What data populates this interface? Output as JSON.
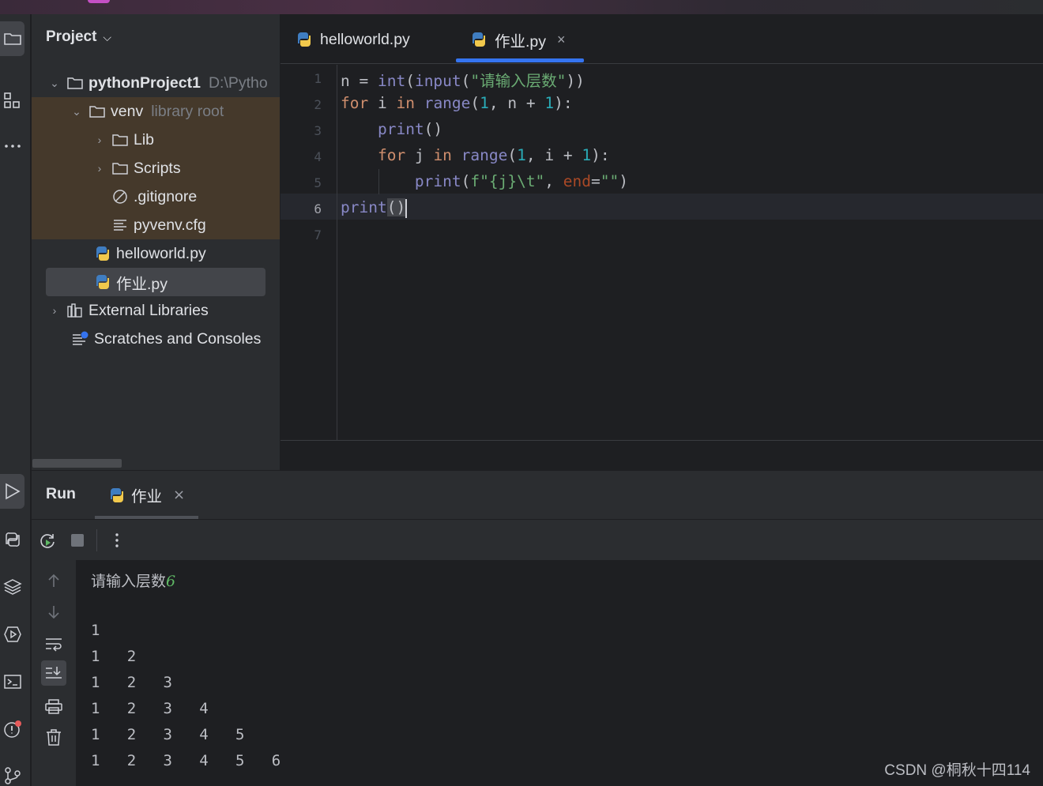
{
  "project_panel": {
    "header": "Project",
    "tree": [
      {
        "label": "pythonProject1",
        "hint": "D:\\Pytho"
      },
      {
        "label": "venv",
        "hint": "library root"
      },
      {
        "label": "Lib"
      },
      {
        "label": "Scripts"
      },
      {
        "label": ".gitignore"
      },
      {
        "label": "pyvenv.cfg"
      },
      {
        "label": "helloworld.py"
      },
      {
        "label": "作业.py"
      },
      {
        "label": "External Libraries"
      },
      {
        "label": "Scratches and Consoles"
      }
    ]
  },
  "editor": {
    "tabs": [
      {
        "label": "helloworld.py"
      },
      {
        "label": "作业.py",
        "close": "×"
      }
    ],
    "line_numbers": [
      "1",
      "2",
      "3",
      "4",
      "5",
      "6",
      "7"
    ],
    "code": {
      "l1_n": "n = ",
      "l1_int": "int",
      "l1_p1": "(",
      "l1_input": "input",
      "l1_p2": "(",
      "l1_str": "\"请输入层数\"",
      "l1_p3": "))",
      "l2_for": "for",
      "l2_i": " i ",
      "l2_in": "in",
      "l2_sp": " ",
      "l2_range": "range",
      "l2_p": "(",
      "l2_1": "1",
      "l2_mid": ", n + ",
      "l2_1b": "1",
      "l2_end": "):",
      "l3_print": "print",
      "l3_p": "()",
      "l4_for": "for",
      "l4_j": " j ",
      "l4_in": "in",
      "l4_sp": " ",
      "l4_range": "range",
      "l4_p": "(",
      "l4_1": "1",
      "l4_mid": ", i + ",
      "l4_1b": "1",
      "l4_end": "):",
      "l5_print": "print",
      "l5_p": "(",
      "l5_str": "f\"{j}\\t\"",
      "l5_comma": ", ",
      "l5_end": "end",
      "l5_eq": "=",
      "l5_str2": "\"\"",
      "l5_close": ")",
      "l6_print": "print",
      "l6_p1": "(",
      "l6_p2": ")"
    }
  },
  "run_panel": {
    "title": "Run",
    "tab_label": "作业",
    "tab_close": "×",
    "console": {
      "prompt": "请输入层数",
      "input": "6",
      "lines": [
        "1",
        "1\t2",
        "1\t2\t3",
        "1\t2\t3\t4",
        "1\t2\t3\t4\t5",
        "1\t2\t3\t4\t5\t6"
      ]
    }
  },
  "watermark": "CSDN @桐秋十四114",
  "colors": {
    "accent": "#3574f0",
    "keyword": "#cf8e6d",
    "function": "#56a8f5",
    "builtin": "#8888c6",
    "number": "#2aacb8",
    "string": "#6aab73",
    "param": "#aa4926",
    "venv_highlight": "#45392b"
  }
}
